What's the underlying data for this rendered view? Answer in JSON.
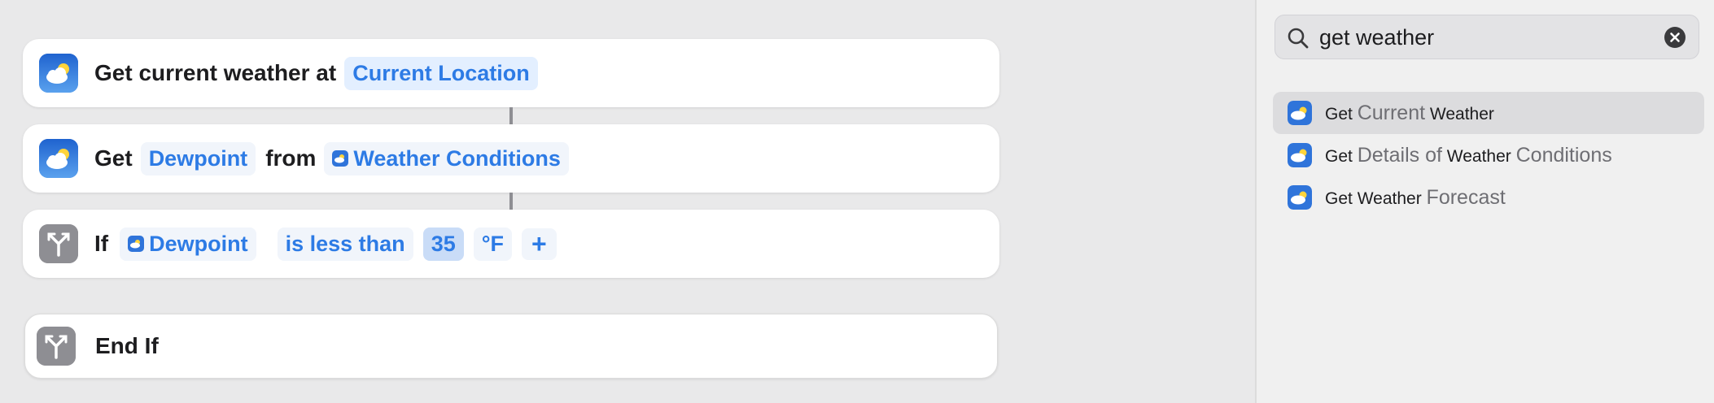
{
  "actions": [
    {
      "prefix": "Get current weather at",
      "param": "Current Location"
    },
    {
      "get_word": "Get",
      "detail_param": "Dewpoint",
      "from_word": "from",
      "source_param": "Weather Conditions"
    },
    {
      "if_word": "If",
      "variable": "Dewpoint",
      "operator": "is less than",
      "value": "35",
      "unit": "°F",
      "add_symbol": "+"
    },
    {
      "label": "End If"
    }
  ],
  "search": {
    "query": "get weather"
  },
  "results": [
    {
      "parts": [
        "Get",
        "Current",
        "Weather"
      ],
      "selected": true
    },
    {
      "parts": [
        "Get",
        "Details of",
        "Weather",
        "Conditions"
      ],
      "selected": false
    },
    {
      "parts": [
        "Get",
        "Weather",
        "Forecast"
      ],
      "selected": false
    }
  ],
  "icons": {
    "weather": "weather-app-icon",
    "branch": "if-branch-icon",
    "search": "search-icon",
    "clear": "clear-search-icon",
    "add": "plus-icon"
  },
  "colors": {
    "accent": "#2d7be5",
    "token_bg": "#e3efff",
    "selected_row": "#dcdcde"
  }
}
